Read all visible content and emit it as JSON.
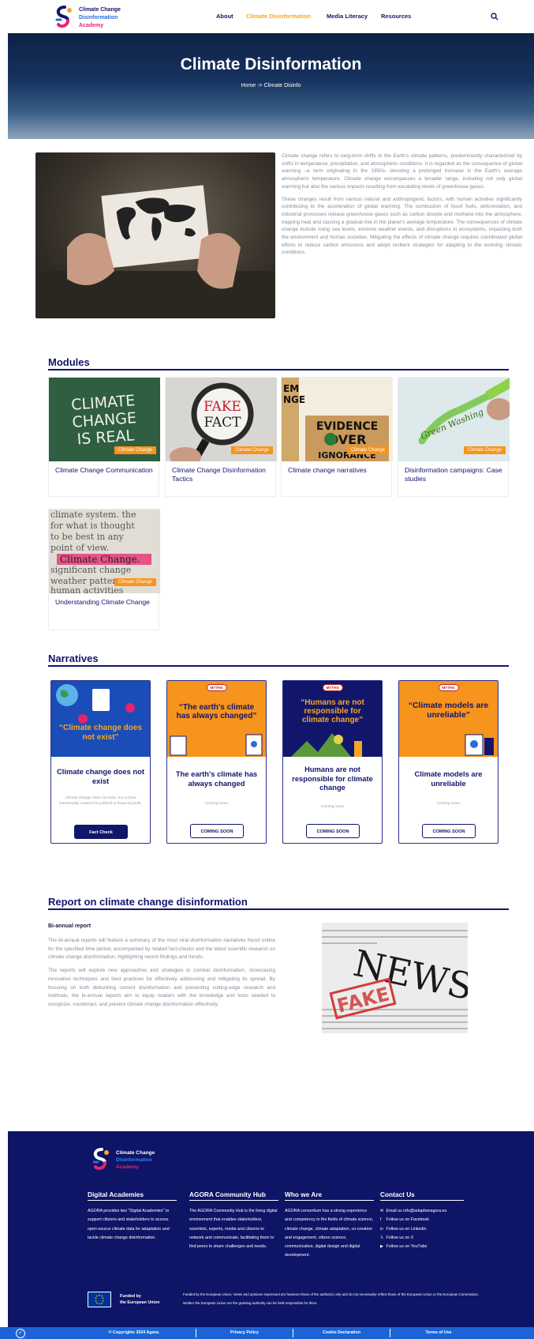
{
  "logo": {
    "line1": "Climate Change",
    "line2": "Disinformation",
    "line3": "Academy"
  },
  "nav": {
    "items": [
      "About",
      "Climate Disinformation",
      "Media Literacy",
      "Resources"
    ],
    "active": "Climate Disinformation",
    "search_icon": "search-icon"
  },
  "hero": {
    "title": "Climate Disinformation",
    "breadcrumb": "Home -> Climate Disinfo"
  },
  "intro": {
    "p1": "Climate change refers to long-term shifts in the Earth's climate patterns, predominantly characterized by shifts in temperature, precipitation, and atmospheric conditions. It is regarded as the consequence of global warming –a term originating in the 1950s- denoting a prolonged increase in the Earth's average atmospheric temperature. Climate change encompasses a broader range, including not only global warming but also the various impacts resulting from escalating levels of greenhouse gases.",
    "p2": "These changes result from various natural and anthropogenic factors, with human activities significantly contributing to the acceleration of global warming. The combustion of fossil fuels, deforestation, and industrial processes release greenhouse gases such as carbon dioxide and methane into the atmosphere, trapping heat and causing a gradual rise in the planet's average temperature. The consequences of climate change include rising sea levels, extreme weather events, and disruptions to ecosystems, impacting both the environment and human societies. Mitigating the effects of climate change requires coordinated global efforts to reduce carbon emissions and adopt resilient strategies for adapting to the evolving climatic conditions."
  },
  "modules": {
    "title": "Modules",
    "cards": [
      {
        "title": "Climate Change Communication",
        "tag": "Climate Change",
        "img_text": "CLIMATE CHANGE IS REAL"
      },
      {
        "title": "Climate Change Disinformation Tactics",
        "tag": "Climate Change",
        "img_text": "FAKE FACT"
      },
      {
        "title": "Climate change narratives",
        "tag": "Climate Change",
        "img_text": "EVIDENCE OVER IGNORANCE"
      },
      {
        "title": "Disinformation campaigns: Case studies",
        "tag": "Climate Change",
        "img_text": "Green Washing"
      },
      {
        "title": "Understanding Climate Change",
        "tag": "Climate Change",
        "img_text": "Climate Change"
      }
    ]
  },
  "narratives": {
    "title": "Narratives",
    "cards": [
      {
        "quote": "“Climate change does not exist”",
        "title": "Climate change does not exist",
        "desc": "Climate change does not exist. It is a hoax intentionally created for political or financial profit.",
        "button": "Fact Check",
        "badge": ""
      },
      {
        "quote": "“The earth's climate has always changed”",
        "title": "The earth's climate has always changed",
        "desc": "Coming Soon",
        "button": "COMING SOON",
        "badge": "MYTHS"
      },
      {
        "quote": "“Humans are not responsible for climate change”",
        "title": "Humans are not responsible for climate change",
        "desc": "Coming Soon",
        "button": "COMING SOON",
        "badge": "MYTHS"
      },
      {
        "quote": "“Climate models are unreliable”",
        "title": "Climate models are unreliable",
        "desc": "Coming Soon",
        "button": "COMING SOON",
        "badge": "MYTHS"
      }
    ]
  },
  "report": {
    "title": "Report on climate change disinformation",
    "subtitle": "Bi-annual report",
    "p1": "The bi-annual reports will feature a summary of the most viral disinformation narratives found online for the specified time period, accompanied by related fact-checks and the latest scientific research on climate change disinformation, highlighting recent findings and trends.",
    "p2": "The reports will explore new approaches and strategies to combat disinformation, showcasing innovative techniques and best practices for effectively addressing and mitigating its spread. By focusing on both debunking current disinformation and presenting cutting-edge research and methods, the bi-annual reports aim to equip readers with the knowledge and tools needed to recognize, counteract, and prevent climate change disinformation effectively.",
    "img_text1": "NEWS",
    "img_text2": "FAKE"
  },
  "footer": {
    "cols": [
      {
        "title": "Digital Academies",
        "text": "AGORA provides two \"Digital Academies\" to support citizens and stakeholders to access open-source climate data for adaptation and tackle climate change disinformation."
      },
      {
        "title": "AGORA Community Hub",
        "text": "The AGORA Community Hub is the living digital environment that enables stakeholders, scientists, experts, media and citizens to network and communicate, facilitating them to find peers to share challenges and needs."
      },
      {
        "title": "Who we Are",
        "text": "AGORA consortium has a strong experience and competency in the fields of climate science, climate change, climate adaptation, co-creation and engagement, citizen science, communication, digital design and digital development."
      }
    ],
    "contact_title": "Contact Us",
    "contacts": [
      {
        "icon": "mail-icon",
        "glyph": "✉",
        "label": "Email us info@adaptionagora.eu"
      },
      {
        "icon": "facebook-icon",
        "glyph": "f",
        "label": "Follow us on Facebook"
      },
      {
        "icon": "linkedin-icon",
        "glyph": "in",
        "label": "Follow us on Linkedin"
      },
      {
        "icon": "x-icon",
        "glyph": "𝕏",
        "label": "Follow us on X"
      },
      {
        "icon": "youtube-icon",
        "glyph": "▶",
        "label": "Follow us on YouTube"
      }
    ],
    "eu_text1": "Funded by",
    "eu_text2": "the European Union",
    "disclaimer": "Funded by the European Union. Views and opinions expressed are however those of the author(s) only and do not necessarily reflect those of the European Union or the European Commission. Neither the European Union nor the granting authority can be held responsible for them.",
    "bottom": [
      "© Copyrights 2024 Agora.",
      "Privacy Policy",
      "Cookie Declaration",
      "Terms of Use"
    ]
  },
  "colors": {
    "navy": "#12166b",
    "accent": "#f5a623",
    "tag": "#f7941d",
    "footer": "#0e1466",
    "bar": "#1b63d6"
  }
}
